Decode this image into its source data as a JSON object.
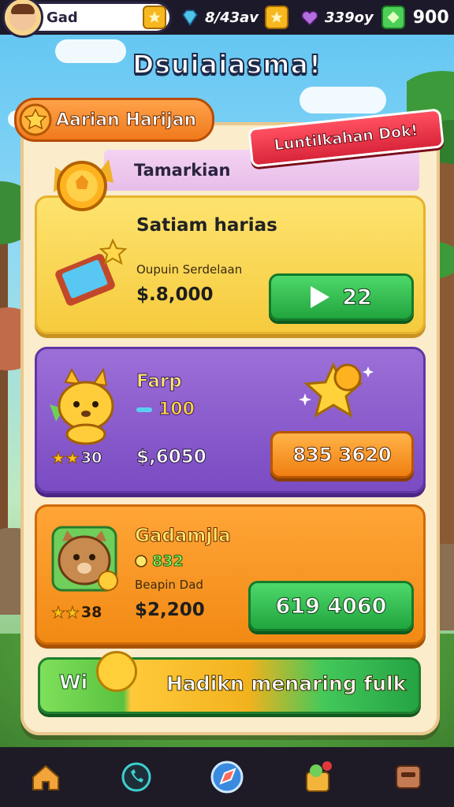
{
  "hud": {
    "player_name": "Gad",
    "resource_1": "8/43av",
    "resource_2": "339oy",
    "resource_3": "900"
  },
  "title": "Dsuiaiasma!",
  "header_tab": "Aarian Harijan",
  "promo_ribbon": "Luntilkahan Dok!",
  "strip_label": "Tamarkian",
  "cards": [
    {
      "title": "Satiam harias",
      "subtitle": "Oupuin Serdelaan",
      "price": "$.8,000",
      "button": "22"
    },
    {
      "title": "Farp",
      "badge": "100",
      "rating": "30",
      "price": "$,6050",
      "button": "835 3620"
    },
    {
      "title": "Gadamjla",
      "badge": "832",
      "subtitle": "Beapin Dad",
      "rating": "38",
      "price": "$2,200",
      "button": "619 4060"
    }
  ],
  "bottom_bar": {
    "left_label": "Wi",
    "cta": "Hadikn menaring fulk"
  },
  "nav": [
    "home-icon",
    "phone-icon",
    "compass-icon",
    "gift-icon",
    "inbox-icon"
  ],
  "colors": {
    "card_yellow": "#f6cb3d",
    "card_purple": "#7a4bc2",
    "card_orange": "#f28a14",
    "button_green": "#21a53e",
    "ribbon_red": "#d9253a"
  }
}
